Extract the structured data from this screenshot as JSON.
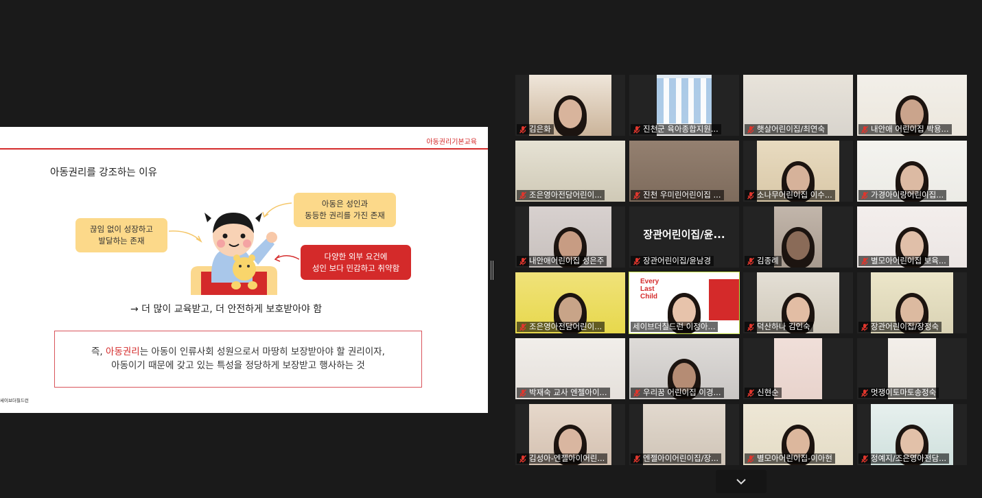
{
  "slide": {
    "tag": "아동권리기본교육",
    "heading": "아동권리를 강조하는 이유",
    "bubble_left": "끊임 없이 성장하고\n발달하는 존재",
    "bubble_top": "아동은 성인과\n동등한 권리를 가진 존재",
    "bubble_red": "다양한 외부 요건에\n성인 보다 민감하고 취약함",
    "arrow_text": "→ 더 많이 교육받고, 더 안전하게 보호받아야 함",
    "summary_pre": "즉, ",
    "summary_highlight": "아동권리",
    "summary_post": "는 아동이 인류사회 성원으로서 마땅히 보장받아야 할 권리이자,",
    "summary_line2": "아동이기 때문에 갖고 있는 특성을 정당하게 보장받고 행사하는 것",
    "logo": "세이브더칠드런"
  },
  "participants": [
    {
      "name": "김은화",
      "muted": true
    },
    {
      "name": "진천군 육아종합지원...",
      "muted": true
    },
    {
      "name": "햇살어린이집/최연숙",
      "muted": true
    },
    {
      "name": "내안애 어린이집 박용...",
      "muted": true
    },
    {
      "name": "조은영아전담어린이...",
      "muted": true
    },
    {
      "name": "진천 우미린어린이집 ...",
      "muted": true
    },
    {
      "name": "소나무어린이집  이수...",
      "muted": true
    },
    {
      "name": "가경아이랑어린이집...",
      "muted": true
    },
    {
      "name": "내안애어린이집 성은주",
      "muted": true
    },
    {
      "name": "장관어린이집/윤남경",
      "muted": true,
      "video_label": "장관어린이집/윤..."
    },
    {
      "name": "김종례",
      "muted": true
    },
    {
      "name": "별모아어린이집 보육...",
      "muted": true
    },
    {
      "name": "조은영아전담어린이...",
      "muted": true
    },
    {
      "name": "세이브더칠드런 이정아...",
      "muted": false,
      "speaking": true,
      "banner": "Every Last Child"
    },
    {
      "name": "덕산하나 김인숙",
      "muted": true
    },
    {
      "name": "장관어린이집/장정숙",
      "muted": true
    },
    {
      "name": "박재숙 교사 엔젤아이...",
      "muted": true
    },
    {
      "name": "우리꿈 어린이집 이경...",
      "muted": true
    },
    {
      "name": "신현순",
      "muted": true
    },
    {
      "name": "멋쟁이토마토송정숙",
      "muted": true
    },
    {
      "name": "김성아-엔젤아이어린...",
      "muted": true
    },
    {
      "name": "엔젤아이어린이집/장...",
      "muted": true
    },
    {
      "name": "별모아어린이집-이아현",
      "muted": true
    },
    {
      "name": "정예지/조은영아전담...",
      "muted": true
    }
  ],
  "controls": {
    "more_icon": "chevron-down-icon"
  }
}
